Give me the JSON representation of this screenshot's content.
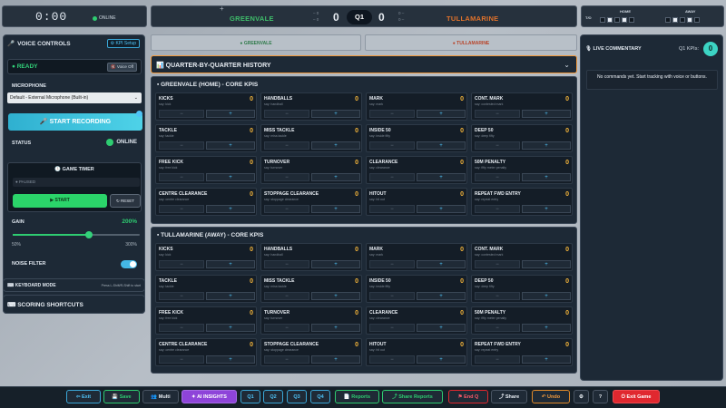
{
  "top_left": {
    "timer": "0:00",
    "status": "ONLINE"
  },
  "scoreboard": {
    "home_team": "GREENVALE",
    "away_team": "TULLAMARINE",
    "home_score": "0",
    "away_score": "0",
    "quarter": "Q1",
    "home_goals_behinds": [
      "0",
      "0"
    ],
    "away_goals_behinds": [
      "0",
      "0"
    ]
  },
  "top_right": {
    "to_label": "T/O",
    "home_label": "HOME",
    "away_label": "AWAY"
  },
  "voice": {
    "title": "VOICE CONTROLS",
    "kpi_setup": "KPI Setup",
    "ready": "READY",
    "voice_off": "Voice Off",
    "microphone_label": "MICROPHONE",
    "microphone_value": "Default - External Microphone (Built-in)",
    "start_recording": "START RECORDING",
    "status_label": "STATUS",
    "status_value": "ONLINE",
    "timer_title": "GAME TIMER",
    "timer_state": "PAUSED",
    "start": "START",
    "reset": "RESET",
    "gain_label": "GAIN",
    "gain_value": "200%",
    "gain_min": "50%",
    "gain_max": "300%",
    "gain_fraction": 0.6,
    "noise_filter": "NOISE FILTER",
    "keyboard_mode": "KEYBOARD MODE",
    "keyboard_hint": "Press L-Shift/R-Shift to start",
    "scoring_shortcuts": "SCORING SHORTCUTS"
  },
  "team_tabs": {
    "home": "GREENVALE",
    "away": "TULLAMARINE"
  },
  "history": {
    "title": "QUARTER-BY-QUARTER HISTORY"
  },
  "home_section": {
    "title": "GREENVALE (HOME) - CORE KPIS",
    "kpis": [
      {
        "name": "KICKS",
        "sub": "say: kick",
        "value": "0"
      },
      {
        "name": "HANDBALLS",
        "sub": "say: handball",
        "value": "0"
      },
      {
        "name": "MARK",
        "sub": "say: mark",
        "value": "0"
      },
      {
        "name": "CONT. MARK",
        "sub": "say: contested mark",
        "value": "0"
      },
      {
        "name": "TACKLE",
        "sub": "say: tackle",
        "value": "0"
      },
      {
        "name": "MISS TACKLE",
        "sub": "say: miss tackle",
        "value": "0"
      },
      {
        "name": "INSIDE 50",
        "sub": "say: inside fifty",
        "value": "0"
      },
      {
        "name": "DEEP 50",
        "sub": "say: deep fifty",
        "value": "0"
      },
      {
        "name": "FREE KICK",
        "sub": "say: free kick",
        "value": "0"
      },
      {
        "name": "TURNOVER",
        "sub": "say: turnover",
        "value": "0"
      },
      {
        "name": "CLEARANCE",
        "sub": "say: clearance",
        "value": "0"
      },
      {
        "name": "50M PENALTY",
        "sub": "say: fifty meter penalty",
        "value": "0"
      },
      {
        "name": "CENTRE CLEARANCE",
        "sub": "say: centre clearance",
        "value": "0"
      },
      {
        "name": "STOPPAGE CLEARANCE",
        "sub": "say: stoppage clearance",
        "value": "0"
      },
      {
        "name": "HITOUT",
        "sub": "say: hit out",
        "value": "0"
      },
      {
        "name": "REPEAT FWD ENTRY",
        "sub": "say: repeat entry",
        "value": "0"
      }
    ]
  },
  "away_section": {
    "title": "TULLAMARINE (AWAY) - CORE KPIS",
    "kpis": [
      {
        "name": "KICKS",
        "sub": "say: kick",
        "value": "0"
      },
      {
        "name": "HANDBALLS",
        "sub": "say: handball",
        "value": "0"
      },
      {
        "name": "MARK",
        "sub": "say: mark",
        "value": "0"
      },
      {
        "name": "CONT. MARK",
        "sub": "say: contested mark",
        "value": "0"
      },
      {
        "name": "TACKLE",
        "sub": "say: tackle",
        "value": "0"
      },
      {
        "name": "MISS TACKLE",
        "sub": "say: miss tackle",
        "value": "0"
      },
      {
        "name": "INSIDE 50",
        "sub": "say: inside fifty",
        "value": "0"
      },
      {
        "name": "DEEP 50",
        "sub": "say: deep fifty",
        "value": "0"
      },
      {
        "name": "FREE KICK",
        "sub": "say: free kick",
        "value": "0"
      },
      {
        "name": "TURNOVER",
        "sub": "say: turnover",
        "value": "0"
      },
      {
        "name": "CLEARANCE",
        "sub": "say: clearance",
        "value": "0"
      },
      {
        "name": "50M PENALTY",
        "sub": "say: fifty meter penalty",
        "value": "0"
      },
      {
        "name": "CENTRE CLEARANCE",
        "sub": "say: centre clearance",
        "value": "0"
      },
      {
        "name": "STOPPAGE CLEARANCE",
        "sub": "say: stoppage clearance",
        "value": "0"
      },
      {
        "name": "HITOUT",
        "sub": "say: hit out",
        "value": "0"
      },
      {
        "name": "REPEAT FWD ENTRY",
        "sub": "say: repeat entry",
        "value": "0"
      }
    ]
  },
  "commentary": {
    "title": "LIVE COMMENTARY",
    "kpi_label": "Q1 KPIs:",
    "kpi_count": "0",
    "empty_message": "No commands yet. Start tracking with voice or buttons."
  },
  "bottom_bar": {
    "exit": "Exit",
    "save": "Save",
    "multi": "Multi",
    "ai": "AI INSIGHTS",
    "q1": "Q1",
    "q2": "Q2",
    "q3": "Q3",
    "q4": "Q4",
    "reports": "Reports",
    "share_reports": "Share Reports",
    "end_q": "End Q",
    "share": "Share",
    "undo": "Undo",
    "exit_game": "Exit Game"
  },
  "colors": {
    "home": "#3fbf6b",
    "away": "#e0722b",
    "accent": "#4fc3f7",
    "ai": "#8e44d9",
    "danger": "#e0282f"
  }
}
